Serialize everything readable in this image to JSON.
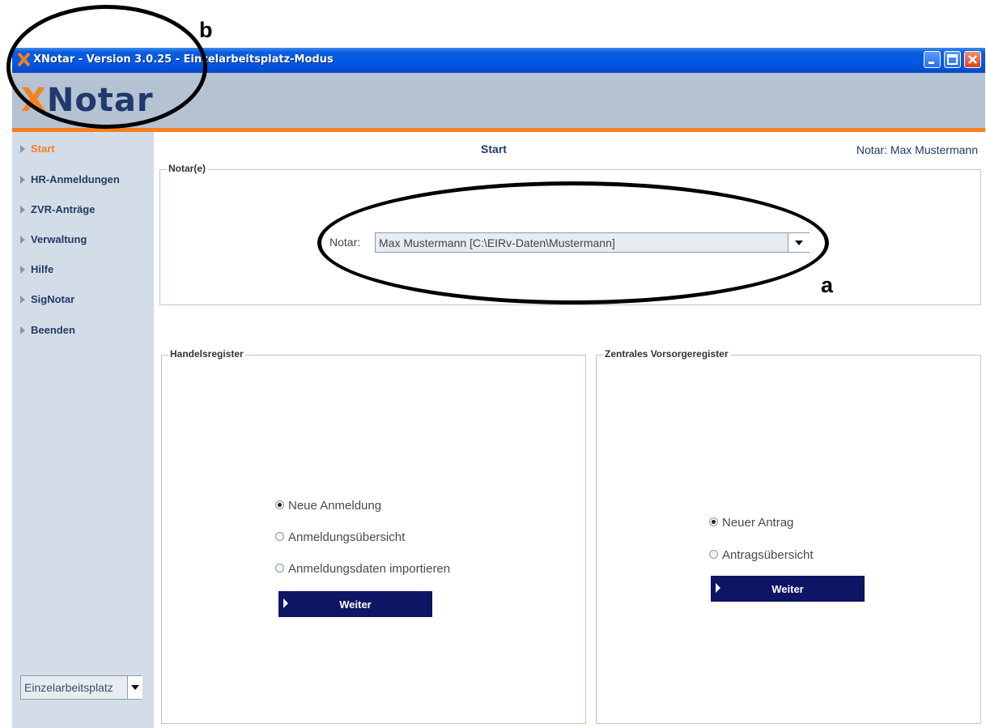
{
  "window": {
    "title": "XNotar - Version 3.0.25 - Einzelarbeitsplatz-Modus",
    "controls": [
      "minimize-icon",
      "maximize-icon",
      "close-icon"
    ],
    "titlebar_color": "#0058e6"
  },
  "logo": {
    "x": "X",
    "rest": "Notar"
  },
  "colors": {
    "accent": "#f57f20",
    "brand": "#1e3a6e",
    "button": "#0e1565"
  },
  "sidebar": {
    "items": [
      {
        "label": "Start",
        "active": true
      },
      {
        "label": "HR-Anmeldungen"
      },
      {
        "label": "ZVR-Anträge"
      },
      {
        "label": "Verwaltung"
      },
      {
        "label": "Hilfe"
      },
      {
        "label": "SigNotar"
      },
      {
        "label": "Beenden"
      }
    ],
    "mode_select": {
      "value": "Einzelarbeitsplatz"
    }
  },
  "content": {
    "title": "Start",
    "notar_status": "Notar: Max Mustermann"
  },
  "notar_group": {
    "title": "Notar(e)",
    "field_label": "Notar:",
    "selected": "Max Mustermann [C:\\EIRv-Daten\\Mustermann]"
  },
  "hr_group": {
    "title": "Handelsregister",
    "options": [
      {
        "label": "Neue Anmeldung",
        "checked": true
      },
      {
        "label": "Anmeldungsübersicht",
        "checked": false
      },
      {
        "label": "Anmeldungsdaten importieren",
        "checked": false
      }
    ],
    "button": "Weiter"
  },
  "zvr_group": {
    "title": "Zentrales Vorsorgeregister",
    "options": [
      {
        "label": "Neuer Antrag",
        "checked": true
      },
      {
        "label": "Antragsübersicht",
        "checked": false
      }
    ],
    "button": "Weiter"
  },
  "annotations": {
    "a": "a",
    "b": "b"
  }
}
